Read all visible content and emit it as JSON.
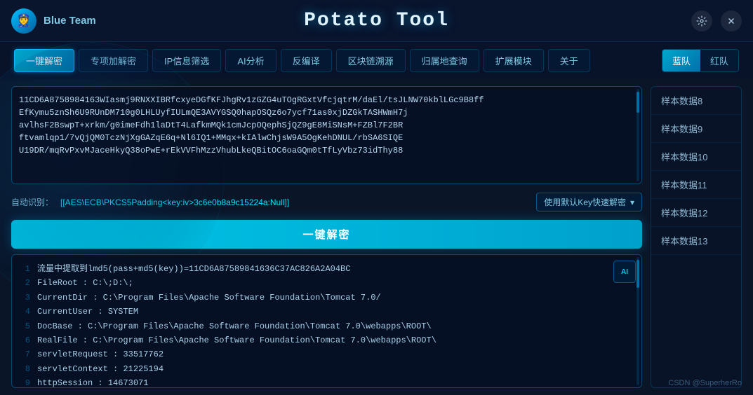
{
  "app": {
    "logo_emoji": "👮",
    "title": "Blue Team",
    "main_title": "Potato Tool",
    "settings_label": "⚙",
    "close_label": "✕"
  },
  "nav": {
    "tabs": [
      {
        "id": "one-click-decrypt",
        "label": "一键解密",
        "active": true
      },
      {
        "id": "special-decrypt",
        "label": "专项加解密",
        "active": false
      },
      {
        "id": "ip-filter",
        "label": "IP信息筛选",
        "active": false
      },
      {
        "id": "ai-analysis",
        "label": "AI分析",
        "active": false
      },
      {
        "id": "decompile",
        "label": "反编译",
        "active": false
      },
      {
        "id": "blockchain",
        "label": "区块链溯源",
        "active": false
      },
      {
        "id": "attribution",
        "label": "归属地查询",
        "active": false
      },
      {
        "id": "extend",
        "label": "扩展模块",
        "active": false
      },
      {
        "id": "about",
        "label": "关于",
        "active": false
      }
    ],
    "team_blue": "蓝队",
    "team_red": "红队"
  },
  "input": {
    "value": "11CD6A8758984163WIasmj9RNXXIBRfcxyeDGfKFJhgRv1zGZG4uTOgRGxtVfcjqtrM/daEl/tsJLNW70kblLGc9B8ff\nEfKymu5znSh6U9RUnDM710g0LHLUyfIULmQE3AVYGSQ0hapOSQz6o7ycf71as0xjDZGkTASHWmH7j\navlhsF2BswpT+xrkm/g0imeFdh1laDtT4LafkmMQk1cmJcpOQephSjQZ9gE8MiSNsM+FZBl7F2BR\nftvamlqp1/7vQjQM0TczNjXgGAZqE6q+Nl6IQ1+MMqx+kIAlwChjsW9A5OgKehDNUL/rbSA6SIQE\nU19DR/mqRvPxvMJaceHkyQ38oPwE+rEkVVFhMzzVhubLkeQBitOC6oaGQm0tTfLyVbz73idThy88"
  },
  "detect": {
    "label": "自动识别：",
    "value": "[[AES\\ECB\\PKCS5Padding<key:iv>3c6e0b8a9c15224a:Null]]",
    "key_btn": "使用默认Key快速解密",
    "dropdown_icon": "▾"
  },
  "decrypt_btn": "一键解密",
  "output": {
    "ai_label": "AI",
    "lines": [
      {
        "num": "1",
        "text": "流量中提取到lmd5(pass+md5(key))=11CD6A87589841636C37AC826A2A04BC"
      },
      {
        "num": "2",
        "text": "FileRoot : C:\\;D:\\;"
      },
      {
        "num": "3",
        "text": "CurrentDir : C:\\Program Files\\Apache Software Foundation\\Tomcat 7.0/"
      },
      {
        "num": "4",
        "text": "CurrentUser : SYSTEM"
      },
      {
        "num": "5",
        "text": "DocBase : C:\\Program Files\\Apache Software Foundation\\Tomcat 7.0\\webapps\\ROOT\\"
      },
      {
        "num": "6",
        "text": "RealFile : C:\\Program Files\\Apache Software Foundation\\Tomcat 7.0\\webapps\\ROOT\\"
      },
      {
        "num": "7",
        "text": "servletRequest : 33517762"
      },
      {
        "num": "8",
        "text": "servletContext : 21225194"
      },
      {
        "num": "9",
        "text": "httpSession : 14673071"
      }
    ]
  },
  "samples": [
    {
      "id": "sample8",
      "label": "样本数据8"
    },
    {
      "id": "sample9",
      "label": "样本数据9"
    },
    {
      "id": "sample10",
      "label": "样本数据10"
    },
    {
      "id": "sample11",
      "label": "样本数据11"
    },
    {
      "id": "sample12",
      "label": "样本数据12"
    },
    {
      "id": "sample13",
      "label": "样本数据13"
    }
  ],
  "footer": {
    "text": "CSDN @SuperherRo"
  }
}
